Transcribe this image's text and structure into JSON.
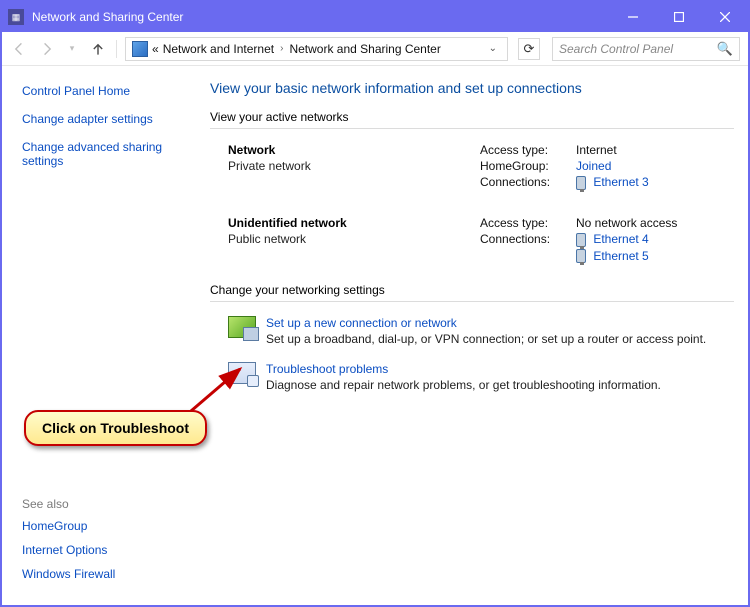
{
  "window": {
    "title": "Network and Sharing Center"
  },
  "breadcrumb": {
    "lead": "«",
    "a": "Network and Internet",
    "b": "Network and Sharing Center"
  },
  "search": {
    "placeholder": "Search Control Panel"
  },
  "sidebar": {
    "home": "Control Panel Home",
    "adapter": "Change adapter settings",
    "advanced": "Change advanced sharing settings"
  },
  "main": {
    "header": "View your basic network information and set up connections",
    "active_hdr": "View your active networks",
    "net1": {
      "name": "Network",
      "type": "Private network",
      "access_lbl": "Access type:",
      "access_val": "Internet",
      "hg_lbl": "HomeGroup:",
      "hg_val": "Joined",
      "conn_lbl": "Connections:",
      "conn_val": "Ethernet 3"
    },
    "net2": {
      "name": "Unidentified network",
      "type": "Public network",
      "access_lbl": "Access type:",
      "access_val": "No network access",
      "conn_lbl": "Connections:",
      "conn_a": "Ethernet 4",
      "conn_b": "Ethernet 5"
    },
    "change_hdr": "Change your networking settings",
    "setup_title": "Set up a new connection or network",
    "setup_desc": "Set up a broadband, dial-up, or VPN connection; or set up a router or access point.",
    "trouble_title": "Troubleshoot problems",
    "trouble_desc": "Diagnose and repair network problems, or get troubleshooting information."
  },
  "seealso": {
    "hdr": "See also",
    "homegroup": "HomeGroup",
    "inetopt": "Internet Options",
    "firewall": "Windows Firewall"
  },
  "annotation": {
    "text": "Click on Troubleshoot"
  }
}
